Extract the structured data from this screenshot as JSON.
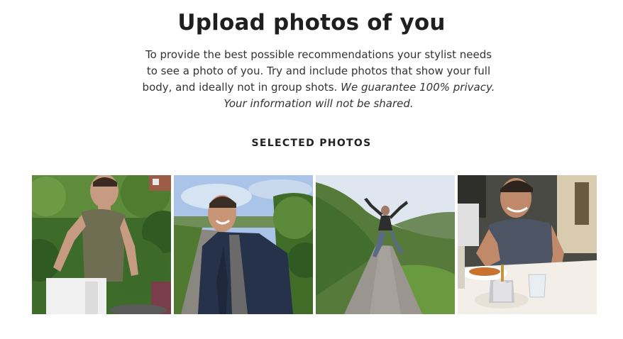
{
  "header": {
    "title": "Upload photos of you",
    "intro_plain": "To provide the best possible recommendations your stylist needs to see a photo of you. Try and include photos that show your full body, and ideally not in group shots. ",
    "intro_italic": "We guarantee 100% privacy. Your information will not be shared."
  },
  "selected": {
    "label": "SELECTED PHOTOS",
    "photos": [
      {
        "name": "photo-barbecue-garden"
      },
      {
        "name": "photo-country-lane-smiling"
      },
      {
        "name": "photo-jumping-on-road"
      },
      {
        "name": "photo-dinner-table"
      }
    ]
  },
  "colors": {
    "text": "#222222",
    "foliage_dark": "#2f5a22",
    "foliage_light": "#6f9a45",
    "sky": "#a9c4e8",
    "road": "#8a8680"
  }
}
